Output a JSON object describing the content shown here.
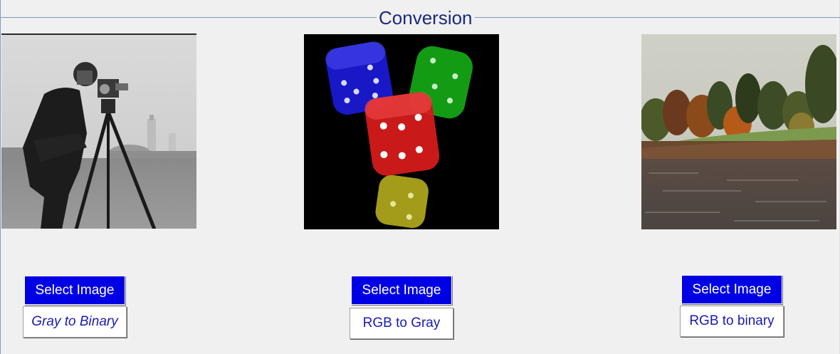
{
  "panel": {
    "title": "Conversion"
  },
  "columns": [
    {
      "image_description": "grayscale photo of a man with a tripod camera",
      "select_label": "Select Image",
      "convert_label": "Gray to Binary"
    },
    {
      "image_description": "four translucent colored dice (blue, green, red, yellow) on black",
      "select_label": "Select Image",
      "convert_label": "RGB to Gray"
    },
    {
      "image_description": "lake with autumn trees",
      "select_label": "Select Image",
      "convert_label": "RGB to binary"
    }
  ],
  "colors": {
    "background": "#f0f0f0",
    "select_button_bg": "#0000e4",
    "select_button_text": "#ffffff",
    "convert_button_text": "#1a1ab0",
    "title_text": "#1a2a80"
  }
}
